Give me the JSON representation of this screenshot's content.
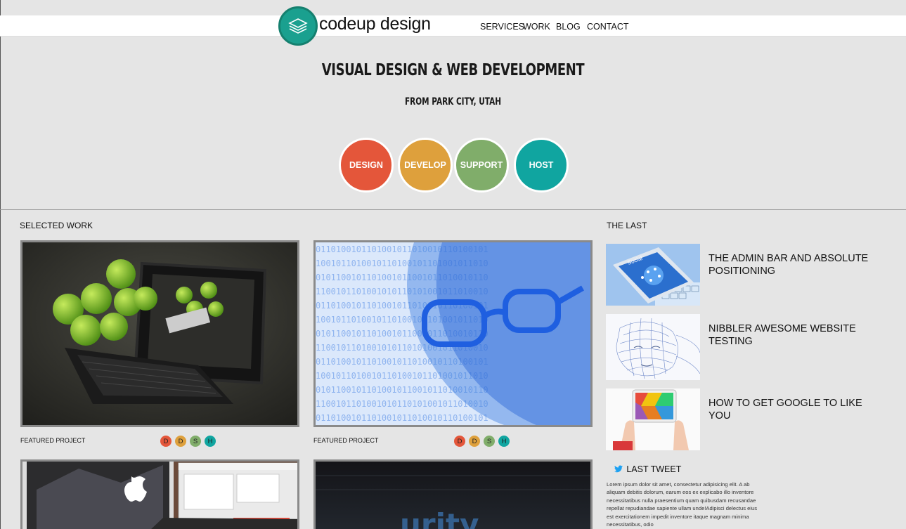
{
  "header": {
    "logo_text": "codeup design",
    "nav": [
      "SERVICES",
      "WORK",
      "BLOG",
      "CONTACT"
    ]
  },
  "hero": {
    "title": "VISUAL DESIGN & WEB DEVELOPMENT",
    "subtitle": "FROM PARK CITY, UTAH",
    "services": [
      {
        "label": "DESIGN",
        "color": "#e4563a"
      },
      {
        "label": "DEVELOP",
        "color": "#dea03c"
      },
      {
        "label": "SUPPORT",
        "color": "#80ad6a"
      },
      {
        "label": "HOST",
        "color": "#10a5a0"
      }
    ]
  },
  "selected_work": {
    "label": "SELECTED WORK",
    "cards": [
      {
        "caption": "FEATURED PROJECT",
        "badges": [
          "D",
          "D",
          "S",
          "H"
        ]
      },
      {
        "caption": "FEATURED PROJECT",
        "badges": [
          "D",
          "D",
          "S",
          "H"
        ]
      }
    ],
    "badge_colors": [
      "#e4563a",
      "#dea03c",
      "#80ad6a",
      "#10a5a0"
    ]
  },
  "the_last": {
    "label": "THE LAST",
    "posts": [
      {
        "title": "THE ADMIN BAR AND ABSOLUTE POSITIONING"
      },
      {
        "title": "NIBBLER AWESOME WEBSITE TESTING"
      },
      {
        "title": "HOW TO GET GOOGLE TO LIKE YOU"
      }
    ]
  },
  "tweet": {
    "label": "LAST TWEET",
    "icon": "twitter-bird-icon",
    "text": "Lorem ipsum dolor sit amet, consectetur adipisicing elit. A ab aliquam debitis dolorum, earum eos ex explicabo illo inventore necessitatibus nulla praesentium quam quibusdam recusandae repellat repudiandae sapiente ullam unde!Adipisci delectus eius est exercitationem impedit inventore itaque magnam minima necessitatibus, odio"
  }
}
